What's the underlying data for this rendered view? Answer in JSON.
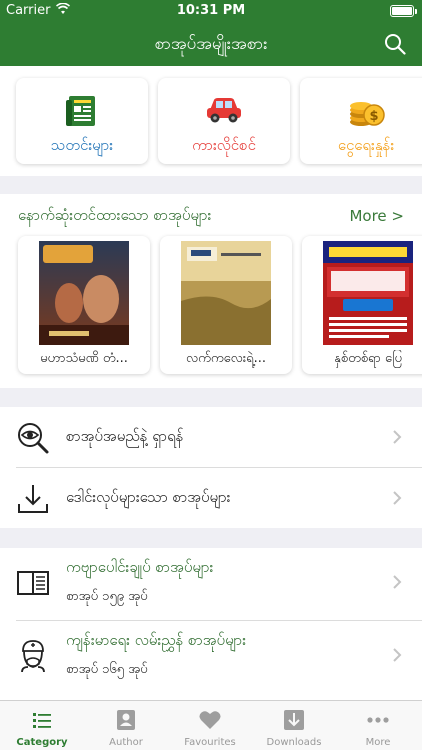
{
  "status_bar": {
    "carrier": "Carrier",
    "time": "10:31 PM"
  },
  "header": {
    "title": "စာအုပ်အမျိုးအစား",
    "search_icon": "search-icon"
  },
  "categories": [
    {
      "label": "သတင်းများ",
      "icon": "newspaper-icon",
      "color": "#1a6fb5"
    },
    {
      "label": "ကားလိုင်စင်",
      "icon": "car-icon",
      "color": "#e53935"
    },
    {
      "label": "ငွေရေးနှုန်း",
      "icon": "coins-icon",
      "color": "#f39c12"
    }
  ],
  "recent": {
    "title": "နောက်ဆုံးတင်ထားသော စာအုပ်များ",
    "more": "More >",
    "books": [
      {
        "title": "မဟာသံမဏိ တံ..."
      },
      {
        "title": "လက်ကလေးရဲ့..."
      },
      {
        "title": "နှစ်တစ်ရာ ပြေ"
      }
    ]
  },
  "search_menu": [
    {
      "label": "စာအုပ်အမည်နဲ့ ရှာရန်",
      "icon": "magnifier-eye-icon"
    },
    {
      "label": "ဒေါင်းလုပ်များသော စာအုပ်များ",
      "icon": "download-icon"
    }
  ],
  "category_list": [
    {
      "title": "ကဗျာပေါင်းချုပ် စာအုပ်များ",
      "count": "စာအုပ် ၁၅၉ အုပ်",
      "icon": "open-book-icon"
    },
    {
      "title": "ကျန်းမာရေး လမ်းညွှန် စာအုပ်များ",
      "count": "စာအုပ် ၁၆၅ အုပ်",
      "icon": "doctor-icon"
    }
  ],
  "tabs": [
    {
      "label": "Category",
      "icon": "list-icon",
      "active": true
    },
    {
      "label": "Author",
      "icon": "author-icon",
      "active": false
    },
    {
      "label": "Favourites",
      "icon": "heart-icon",
      "active": false
    },
    {
      "label": "Downloads",
      "icon": "download-tab-icon",
      "active": false
    },
    {
      "label": "More",
      "icon": "more-dots-icon",
      "active": false
    }
  ],
  "colors": {
    "brand_green": "#2e7d32",
    "active_tab": "#2e7d32",
    "inactive_tab": "#999999"
  }
}
